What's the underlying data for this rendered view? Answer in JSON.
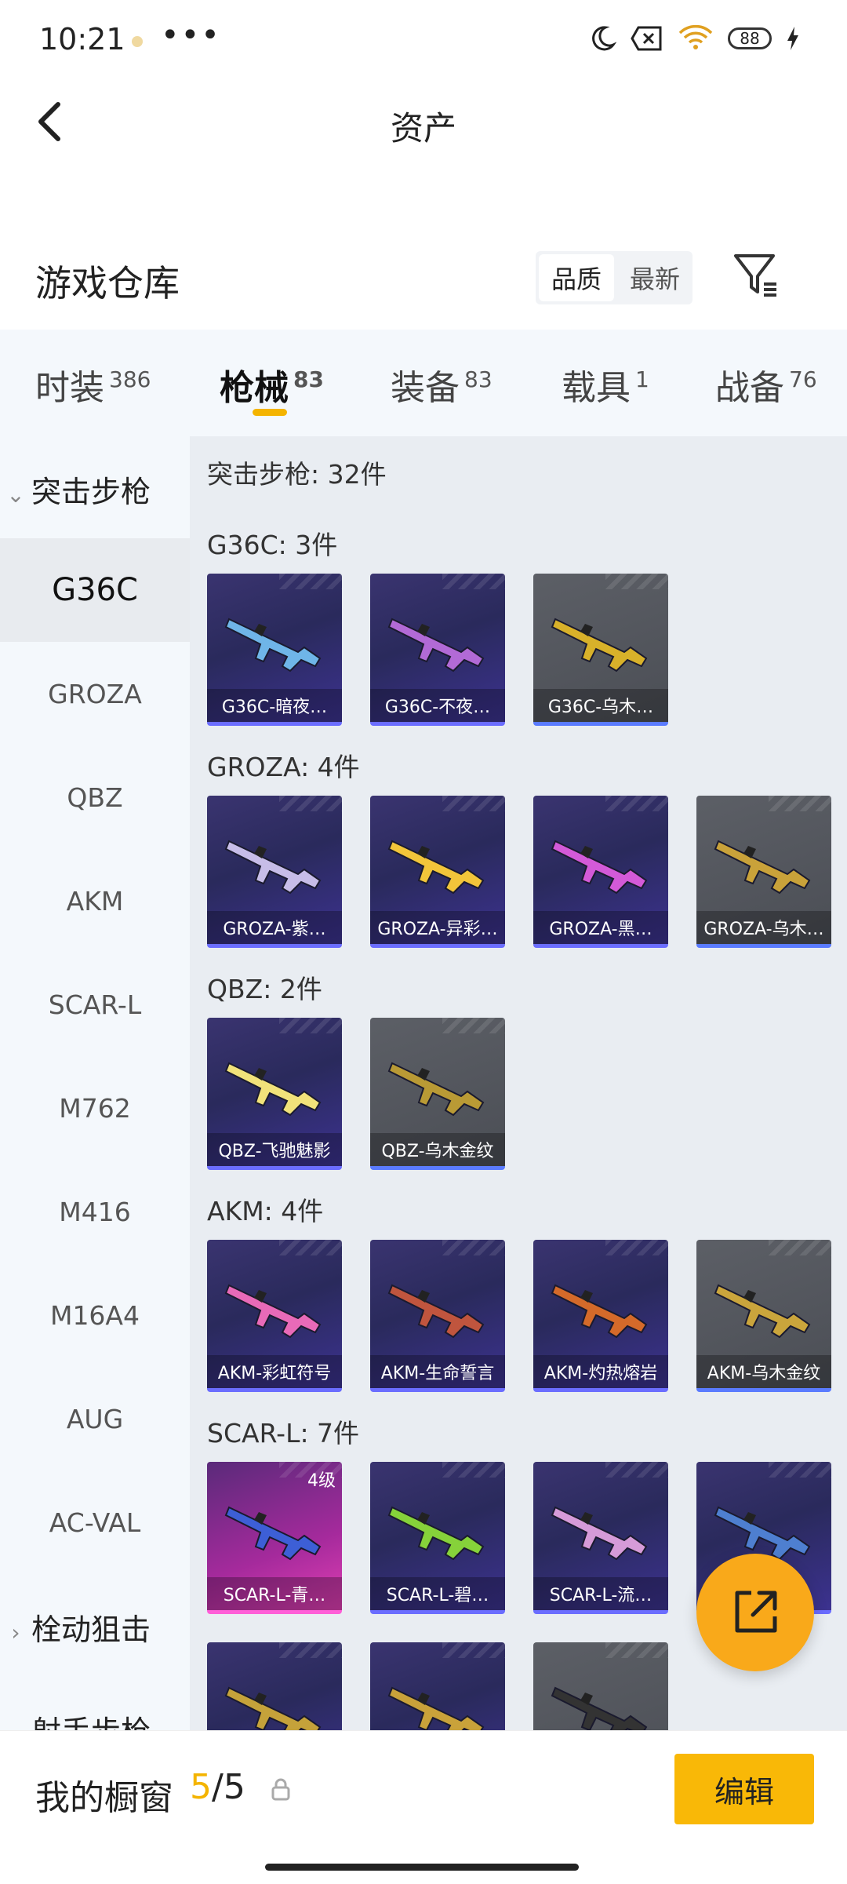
{
  "status": {
    "time": "10:21",
    "more": "•••",
    "battery": "88"
  },
  "header": {
    "title": "资产"
  },
  "warehouse": {
    "title": "游戏仓库",
    "sort_options": [
      "品质",
      "最新"
    ],
    "sort_selected": "品质"
  },
  "tabs": [
    {
      "label": "时装",
      "count": "386"
    },
    {
      "label": "枪械",
      "count": "83",
      "active": true
    },
    {
      "label": "装备",
      "count": "83"
    },
    {
      "label": "载具",
      "count": "1"
    },
    {
      "label": "战备",
      "count": "76"
    }
  ],
  "sidebar": {
    "group_open": "突击步枪",
    "items": [
      "G36C",
      "GROZA",
      "QBZ",
      "AKM",
      "SCAR-L",
      "M762",
      "M416",
      "M16A4",
      "AUG",
      "AC-VAL"
    ],
    "active_item": "G36C",
    "group_collapsed_1": "栓动狙击",
    "group_collapsed_2": "射手步枪"
  },
  "content": {
    "summary": "突击步枪: 32件",
    "sections": [
      {
        "title": "G36C: 3件",
        "cards": [
          {
            "label": "G36C-暗夜…",
            "style": "purple",
            "gun": "#6fb5e8"
          },
          {
            "label": "G36C-不夜…",
            "style": "purple",
            "gun": "#b26ad6"
          },
          {
            "label": "G36C-乌木…",
            "style": "gray",
            "gun": "#d8b12a"
          }
        ]
      },
      {
        "title": "GROZA: 4件",
        "cards": [
          {
            "label": "GROZA-紫…",
            "style": "purple",
            "gun": "#c7bde8"
          },
          {
            "label": "GROZA-异彩…",
            "style": "purple",
            "gun": "#f2c53a"
          },
          {
            "label": "GROZA-黑…",
            "style": "purple",
            "gun": "#d35ad8"
          },
          {
            "label": "GROZA-乌木…",
            "style": "gray",
            "gun": "#c9a23a"
          }
        ]
      },
      {
        "title": "QBZ: 2件",
        "cards": [
          {
            "label": "QBZ-飞驰魅影",
            "style": "purple",
            "gun": "#f1e27a"
          },
          {
            "label": "QBZ-乌木金纹",
            "style": "gray",
            "gun": "#b99a35"
          }
        ]
      },
      {
        "title": "AKM: 4件",
        "cards": [
          {
            "label": "AKM-彩虹符号",
            "style": "purple",
            "gun": "#e86ab8"
          },
          {
            "label": "AKM-生命誓言",
            "style": "purple",
            "gun": "#c0553e"
          },
          {
            "label": "AKM-灼热熔岩",
            "style": "purple",
            "gun": "#d46a2a"
          },
          {
            "label": "AKM-乌木金纹",
            "style": "gray",
            "gun": "#caa53c"
          }
        ]
      },
      {
        "title": "SCAR-L: 7件",
        "cards": [
          {
            "label": "SCAR-L-青…",
            "style": "pink",
            "gun": "#3d5fd6",
            "level": "4级"
          },
          {
            "label": "SCAR-L-碧…",
            "style": "purple",
            "gun": "#86d23a"
          },
          {
            "label": "SCAR-L-流…",
            "style": "purple",
            "gun": "#d69bd8"
          },
          {
            "label": "",
            "style": "purple",
            "gun": "#4e7fd0"
          }
        ]
      },
      {
        "title": "",
        "cards": [
          {
            "label": "",
            "style": "purple",
            "gun": "#c5a23a"
          },
          {
            "label": "",
            "style": "purple",
            "gun": "#c9a23a"
          },
          {
            "label": "",
            "style": "gray",
            "gun": "#333333"
          }
        ]
      }
    ]
  },
  "window": {
    "label": "我的橱窗",
    "current": "5",
    "sep": "/",
    "total": "5"
  },
  "edit_button": "编辑",
  "colors": {
    "accent": "#f4b400",
    "button": "#f9b807",
    "fab": "#f9a91a"
  }
}
